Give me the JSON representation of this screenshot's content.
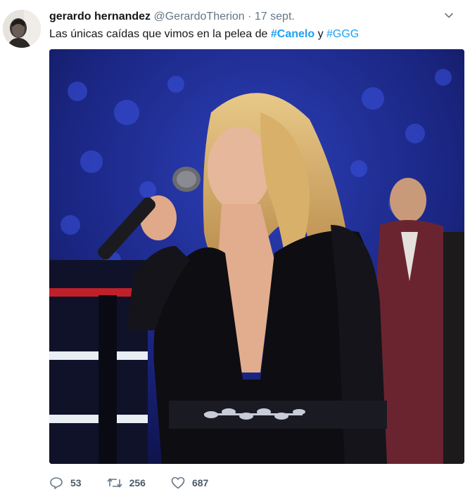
{
  "tweet": {
    "display_name": "gerardo hernandez",
    "handle": "@GerardoTherion",
    "separator": "·",
    "date": "17 sept.",
    "text_before": "Las únicas caídas que vimos en la pelea de ",
    "hashtag1": "#Canelo",
    "text_middle": " y ",
    "hashtag2": "#GGG"
  },
  "actions": {
    "replies": "53",
    "retweets": "256",
    "likes": "687"
  },
  "icons": {
    "reply": "reply-icon",
    "retweet": "retweet-icon",
    "like": "heart-icon",
    "menu": "chevron-down-icon"
  },
  "colors": {
    "link": "#1da1f2",
    "text": "#14171a",
    "muted": "#657786"
  }
}
